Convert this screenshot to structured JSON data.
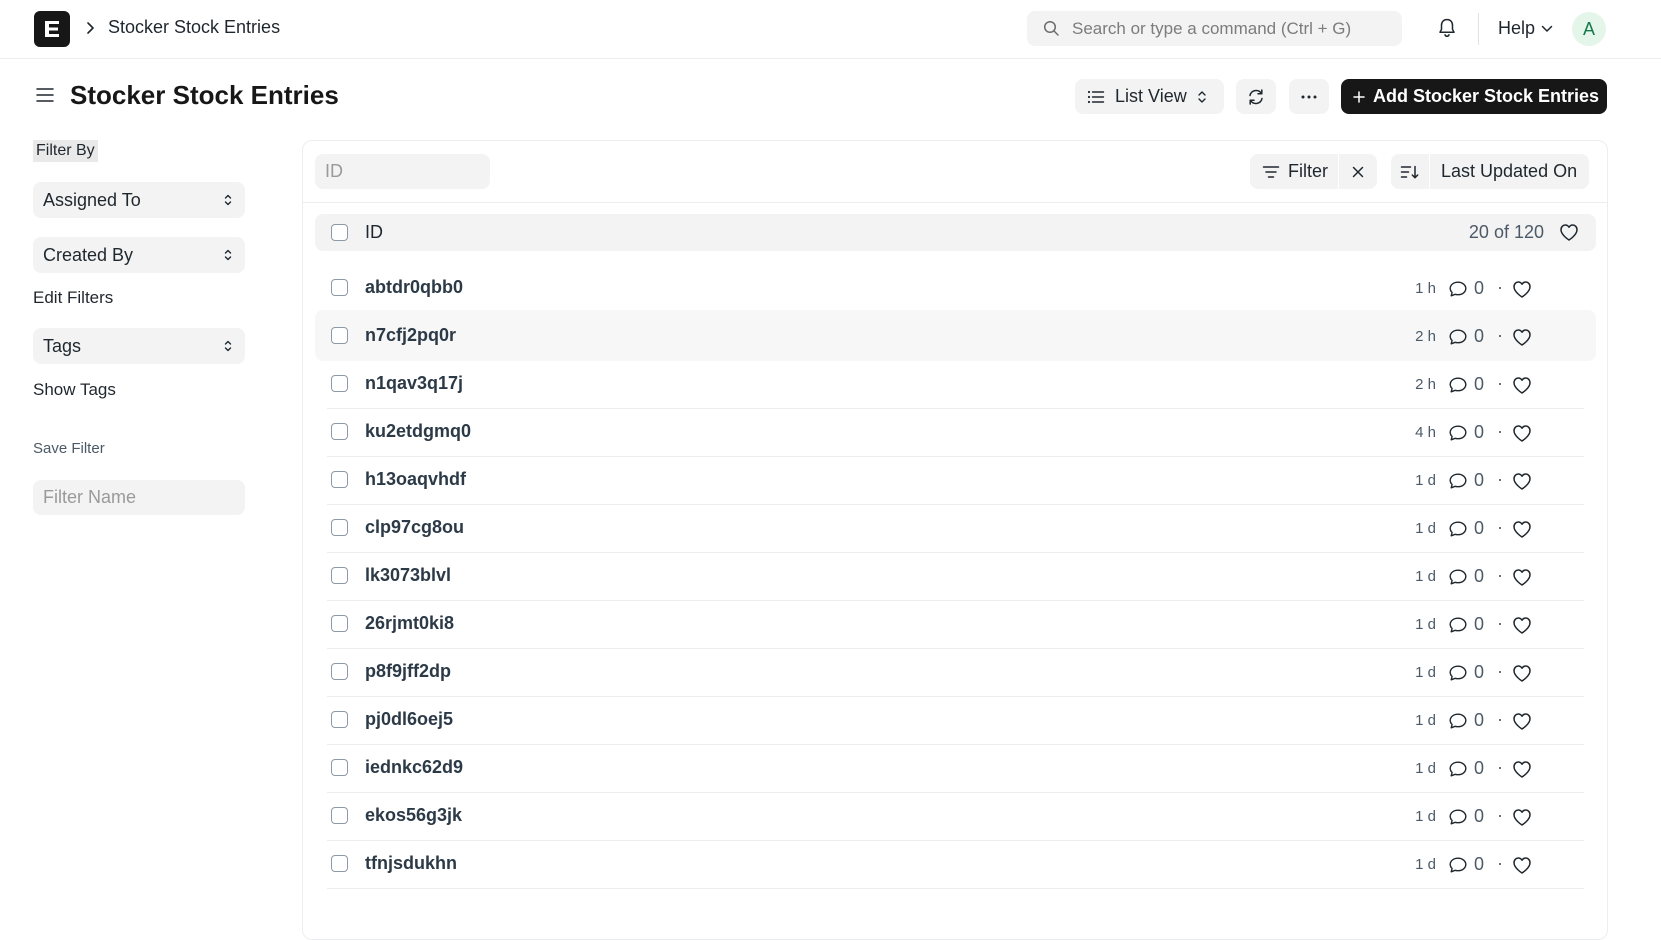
{
  "navbar": {
    "breadcrumb": "Stocker Stock Entries",
    "search_placeholder": "Search or type a command (Ctrl + G)",
    "help_label": "Help",
    "avatar_initial": "A"
  },
  "page": {
    "title": "Stocker Stock Entries",
    "view_label": "List View",
    "add_button_label": "Add Stocker Stock Entries"
  },
  "sidebar": {
    "filter_by_label": "Filter By",
    "assigned_to": "Assigned To",
    "created_by": "Created By",
    "edit_filters": "Edit Filters",
    "tags": "Tags",
    "show_tags": "Show Tags",
    "save_filter": "Save Filter",
    "filter_name_placeholder": "Filter Name"
  },
  "list": {
    "id_filter_placeholder": "ID",
    "filter_label": "Filter",
    "sort_label": "Last Updated On",
    "header_id": "ID",
    "count_text": "20 of 120",
    "rows": [
      {
        "id": "abtdr0qbb0",
        "time": "1 h",
        "comments": "0"
      },
      {
        "id": "n7cfj2pq0r",
        "time": "2 h",
        "comments": "0"
      },
      {
        "id": "n1qav3q17j",
        "time": "2 h",
        "comments": "0"
      },
      {
        "id": "ku2etdgmq0",
        "time": "4 h",
        "comments": "0"
      },
      {
        "id": "h13oaqvhdf",
        "time": "1 d",
        "comments": "0"
      },
      {
        "id": "clp97cg8ou",
        "time": "1 d",
        "comments": "0"
      },
      {
        "id": "lk3073blvl",
        "time": "1 d",
        "comments": "0"
      },
      {
        "id": "26rjmt0ki8",
        "time": "1 d",
        "comments": "0"
      },
      {
        "id": "p8f9jff2dp",
        "time": "1 d",
        "comments": "0"
      },
      {
        "id": "pj0dl6oej5",
        "time": "1 d",
        "comments": "0"
      },
      {
        "id": "iednkc62d9",
        "time": "1 d",
        "comments": "0"
      },
      {
        "id": "ekos56g3jk",
        "time": "1 d",
        "comments": "0"
      },
      {
        "id": "tfnjsdukhn",
        "time": "1 d",
        "comments": "0"
      }
    ]
  },
  "colors": {
    "primary": "#171717",
    "control_bg": "#f3f3f3",
    "avatar_bg": "#e4f5e9",
    "avatar_fg": "#16794c"
  }
}
